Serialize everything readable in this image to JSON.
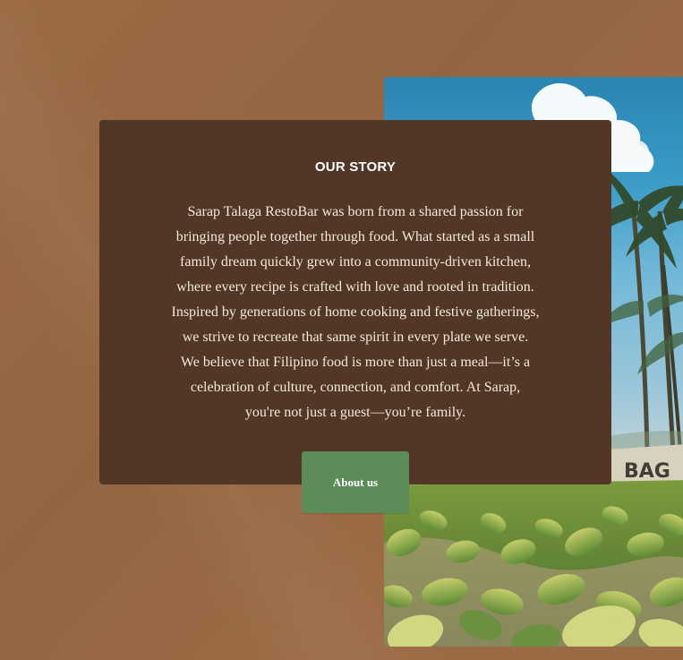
{
  "story": {
    "title": "OUR STORY",
    "body": "Sarap Talaga RestoBar was born from a shared passion for\nbringing people together through food. What started as a small\nfamily dream quickly grew into a community-driven kitchen,\nwhere every recipe is crafted with love and rooted in tradition.\nInspired by generations of home cooking and festive gatherings,\nwe strive to recreate that same spirit in every plate we serve.\nWe believe that Filipino food is more than just a meal—it’s a\ncelebration of culture, connection, and comfort. At Sarap,\nyou're not just a guest—you’re family.",
    "button_label": "About us"
  },
  "colors": {
    "background": "#9b6b45",
    "card": "#523727",
    "button": "#5c8d59",
    "text": "#f3e8dc"
  },
  "image": {
    "icon": "tropical-photo-icon"
  }
}
